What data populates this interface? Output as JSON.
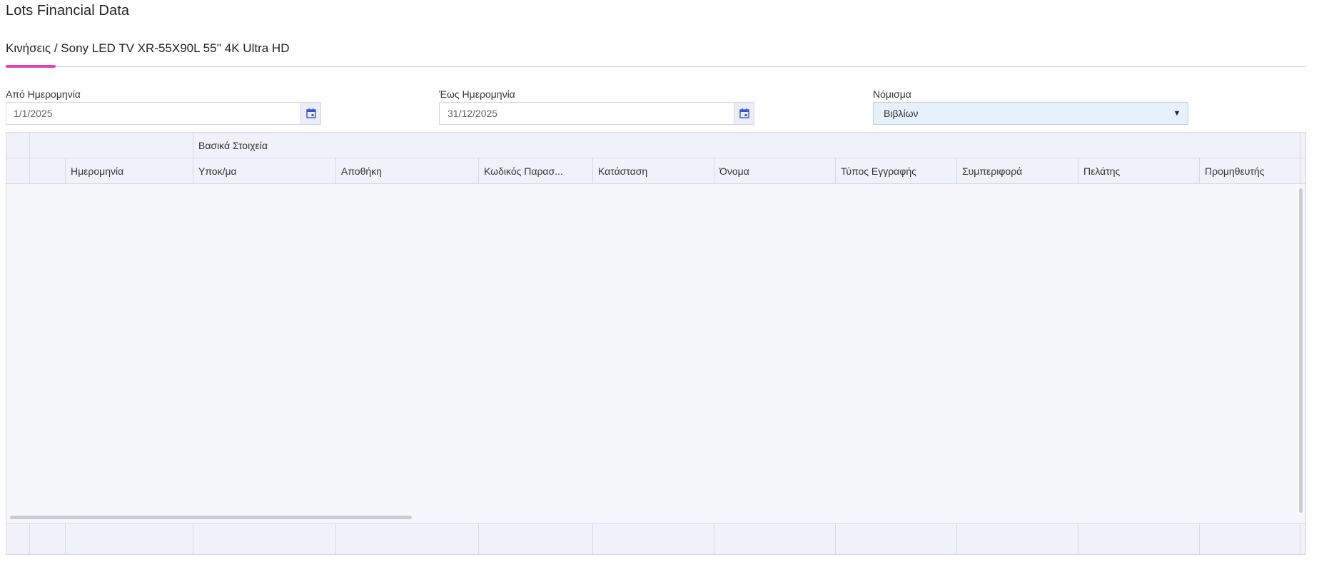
{
  "page": {
    "title": "Lots Financial Data"
  },
  "tab": {
    "label": "Κινήσεις / Sony LED TV XR-55X90L 55'' 4K Ultra HD"
  },
  "filters": {
    "from_date": {
      "label": "Από Ημερομηνία",
      "value": "1/1/2025"
    },
    "to_date": {
      "label": "Έως Ημερομηνία",
      "value": "31/12/2025"
    },
    "currency": {
      "label": "Νόμισμα",
      "value": "Βιβλίων"
    }
  },
  "grid": {
    "group_header": "Βασικά Στοιχεία",
    "columns": [
      "Ημερομηνία",
      "Υποκ/μα",
      "Αποθήκη",
      "Κωδικός Παρασ...",
      "Κατάσταση",
      "Όνομα",
      "Τύπος Εγγραφής",
      "Συμπεριφορά",
      "Πελάτης",
      "Προμηθευτής"
    ],
    "rows": []
  },
  "colors": {
    "accent": "#e040c0",
    "select_bg": "#e6f1fc",
    "header_bg": "#f0f2f9"
  },
  "icons": {
    "date_picker": "calendar-icon",
    "dropdown": "chevron-down-icon"
  }
}
